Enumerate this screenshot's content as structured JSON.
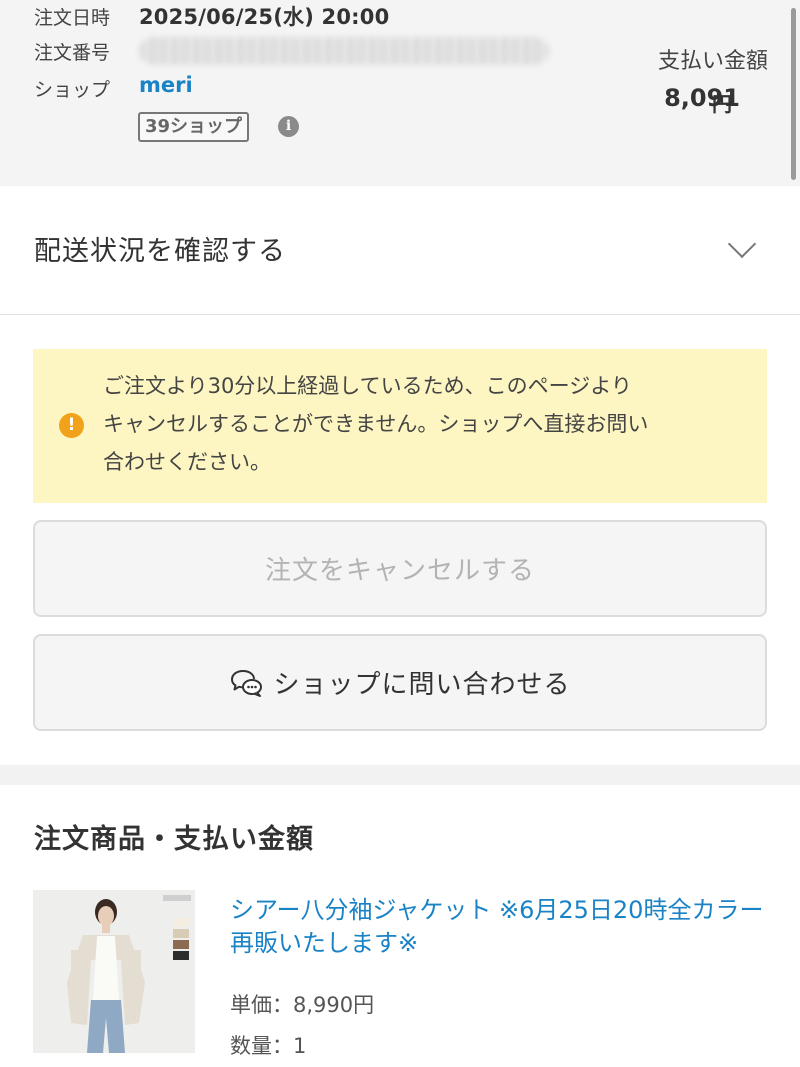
{
  "order": {
    "date_label": "注文日時",
    "date_value": "2025/06/25(水) 20:00",
    "number_label": "注文番号",
    "shop_label": "ショップ",
    "shop_name": "meri",
    "badge": "39ショップ",
    "info_icon_glyph": "i",
    "payment_label": "支払い金額",
    "payment_value": "8,091",
    "payment_unit": "円"
  },
  "delivery": {
    "label": "配送状況を確認する"
  },
  "notice": {
    "icon_glyph": "!",
    "line1": "ご注文より30分以上経過しているため、このページより",
    "line2": "キャンセルすることができません。ショップへ直接お問い",
    "line3": "合わせください。"
  },
  "buttons": {
    "cancel": "注文をキャンセルする",
    "contact": "ショップに問い合わせる"
  },
  "items_section": {
    "title": "注文商品・支払い金額",
    "product": {
      "name": "シアー八分袖ジャケット ※6月25日20時全カラー再販いたします※",
      "unit_price": "単価：8,990円",
      "quantity": "数量：1"
    }
  },
  "colors": {
    "link": "#1a83c6",
    "notice_bg": "#fdf6c2",
    "notice_icon": "#f0a21b"
  },
  "icons": [
    "info-icon",
    "chevron-down-icon",
    "warning-icon",
    "chat-icon"
  ]
}
